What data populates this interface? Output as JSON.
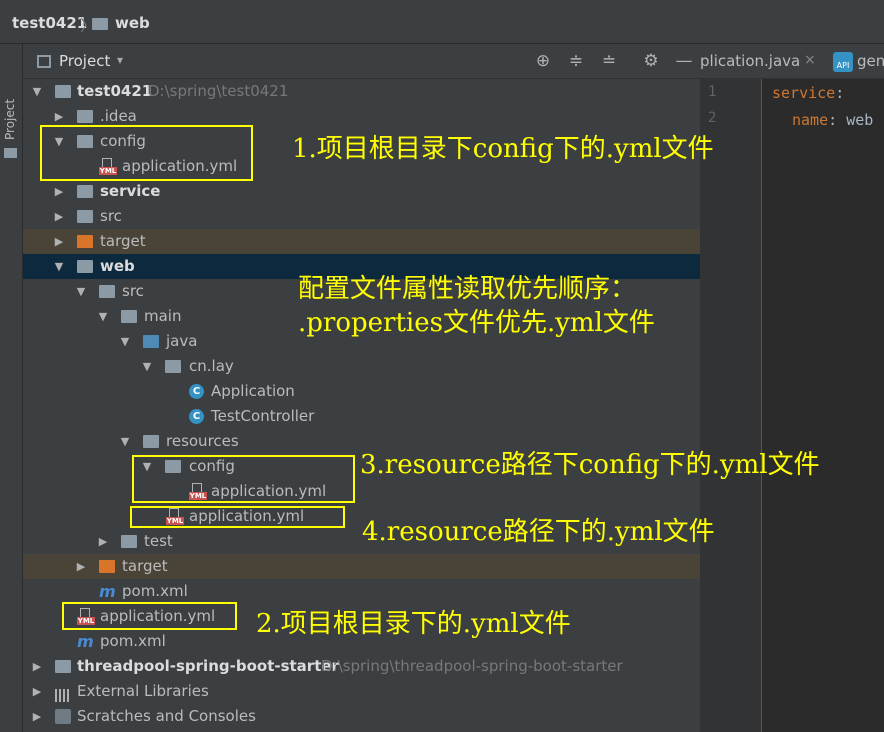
{
  "breadcrumb": {
    "project": "test0421",
    "separator": "〉",
    "module": "web"
  },
  "left_strip": {
    "tab_label": "Project"
  },
  "panel": {
    "title": "Project",
    "caret": "▾"
  },
  "editor": {
    "tab1": "plication.java",
    "tab1_close": "×",
    "tab2_icon": "API",
    "tab2": "gen",
    "lines": [
      "1",
      "2"
    ],
    "code": {
      "line1_key": "service",
      "line1_colon": ":",
      "line2_key": "name",
      "line2_colon": ":",
      "line2_value": "web"
    }
  },
  "tree": {
    "root": {
      "name": "test0421",
      "path": "D:\\spring\\test0421"
    },
    "idea": ".idea",
    "config": "config",
    "config_yml": "application.yml",
    "service": "service",
    "src": "src",
    "target": "target",
    "web": "web",
    "web_src": "src",
    "main": "main",
    "java": "java",
    "pkg": "cn.lay",
    "app": "Application",
    "controller": "TestController",
    "resources": "resources",
    "res_config": "config",
    "res_config_yml": "application.yml",
    "res_yml": "application.yml",
    "test": "test",
    "web_target": "target",
    "web_pom": "pom.xml",
    "root_yml": "application.yml",
    "root_pom": "pom.xml",
    "threadpool": {
      "name": "threadpool-spring-boot-starter",
      "path": "D:\\spring\\threadpool-spring-boot-starter"
    },
    "libs": "External Libraries",
    "scratches": "Scratches and Consoles"
  },
  "annotations": {
    "a1": "1.项目根目录下config下的.yml文件",
    "a_title1": "配置文件属性读取优先顺序：",
    "a_title2": ".properties文件优先.yml文件",
    "a3": "3.resource路径下config下的.yml文件",
    "a4": "4.resource路径下的.yml文件",
    "a2": "2.项目根目录下的.yml文件"
  },
  "colors": {
    "annotation": "#ffff00",
    "selection": "#0d293e",
    "excluded": "#4a4438"
  }
}
